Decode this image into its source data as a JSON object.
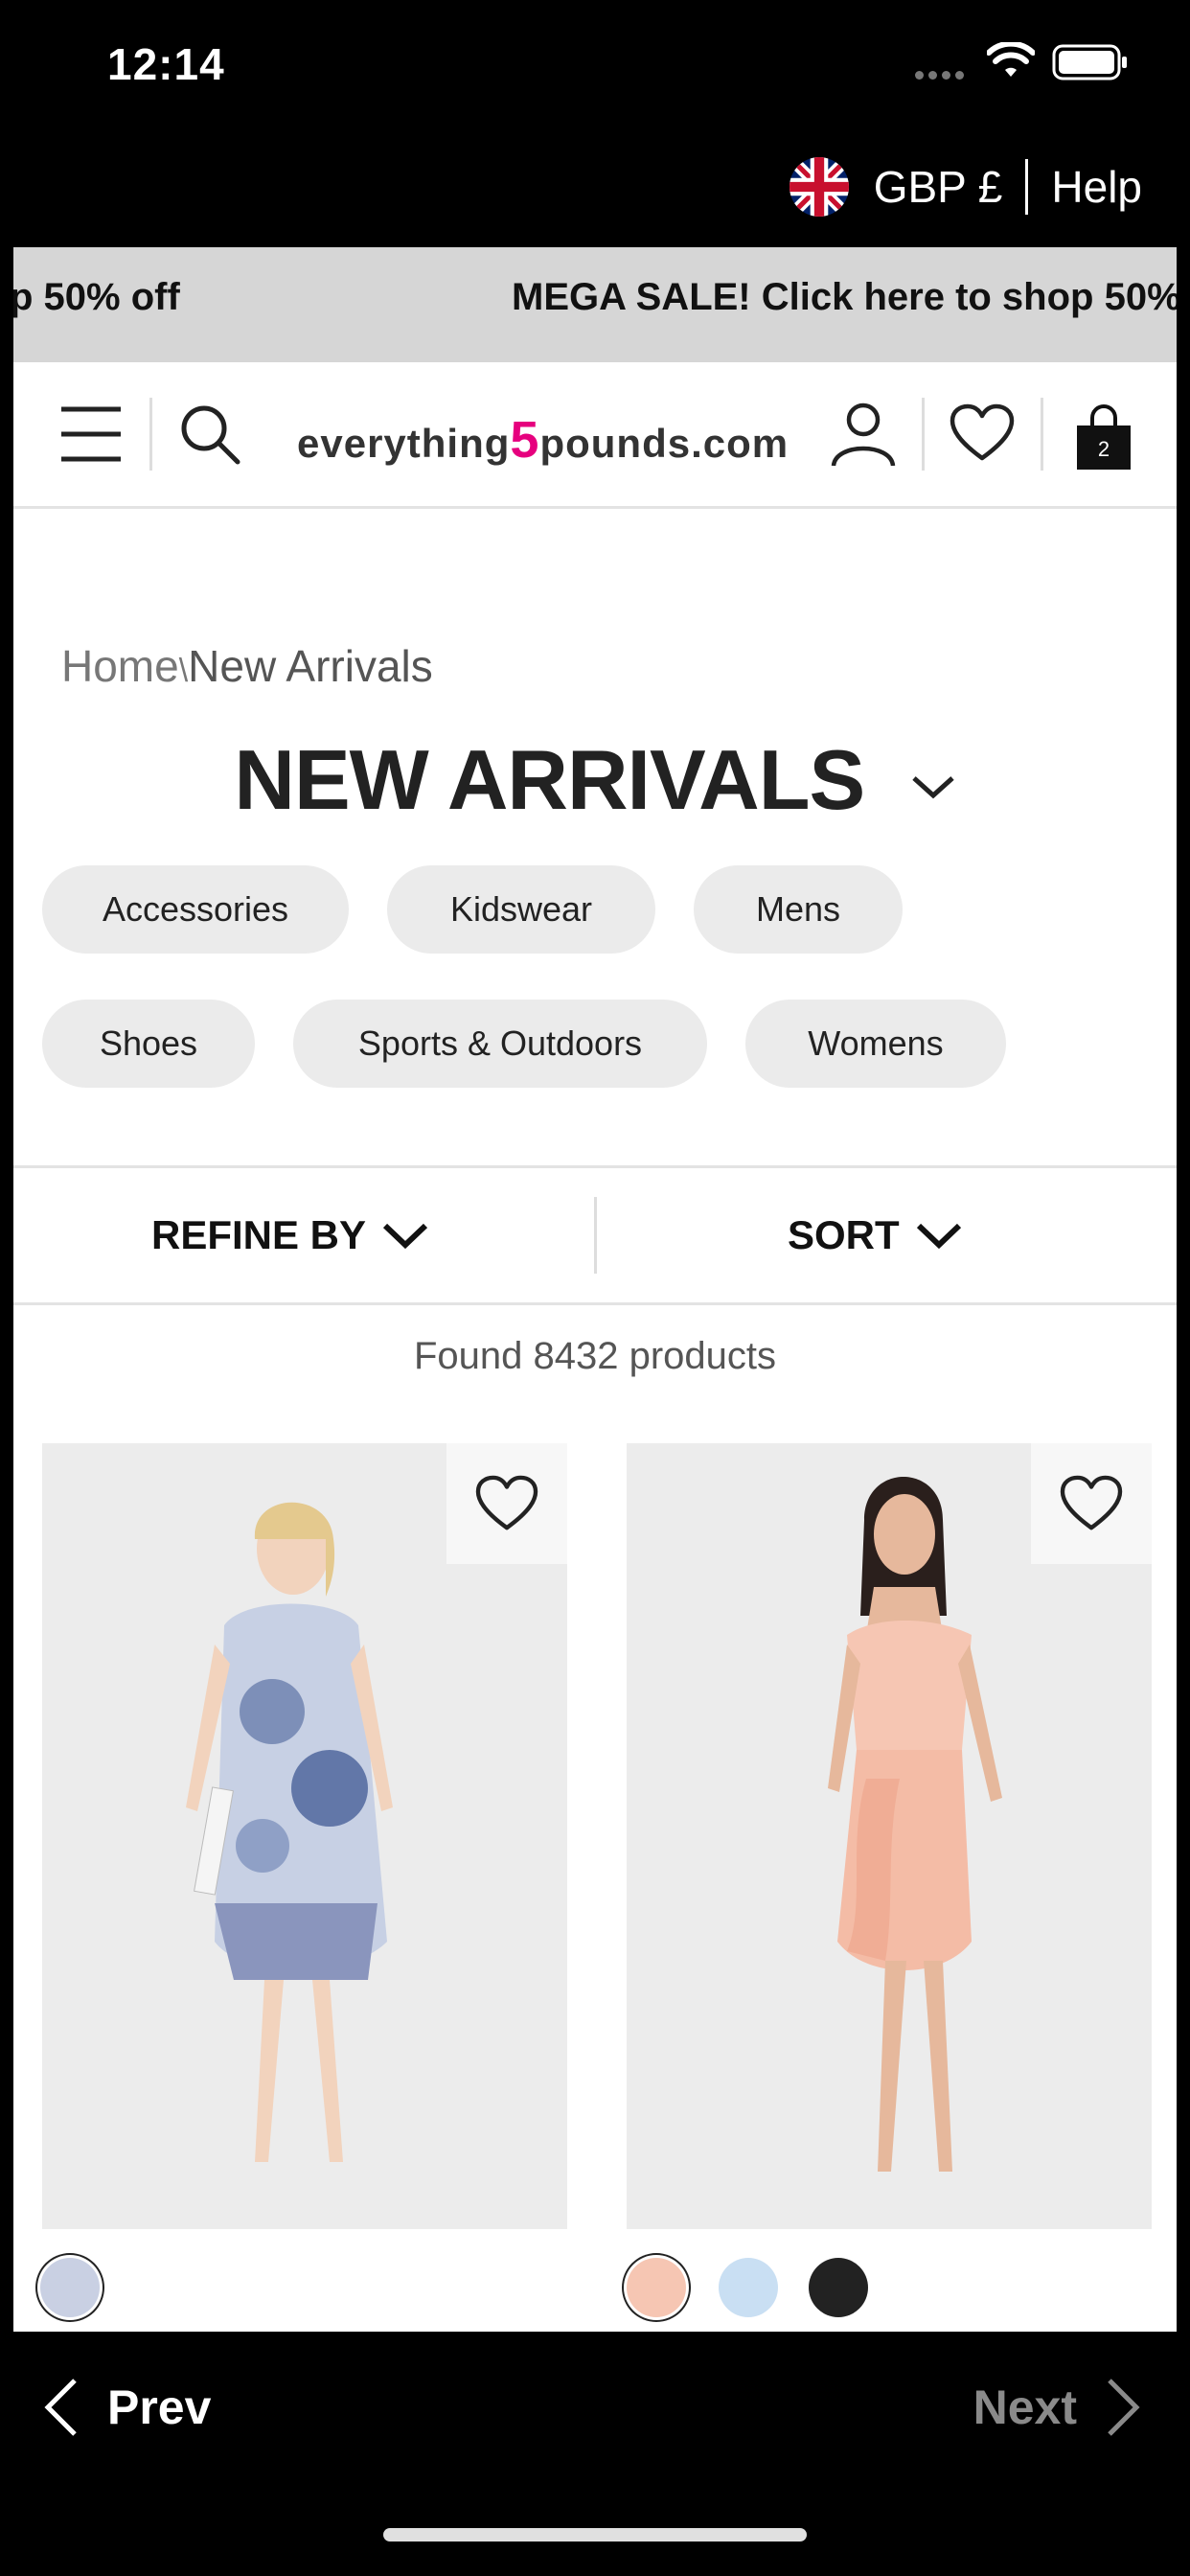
{
  "status_bar": {
    "time": "12:14"
  },
  "locale": {
    "currency": "GBP £",
    "help": "Help"
  },
  "promo": {
    "text_left": "p 50% off",
    "text_right": "MEGA SALE! Click here to shop 50%"
  },
  "header": {
    "logo_part1": "everything",
    "logo_five": "5",
    "logo_part2": "pounds.com",
    "bag_count": "2"
  },
  "breadcrumb": {
    "home": "Home",
    "separator": "\\",
    "current": "New Arrivals"
  },
  "page": {
    "title": "NEW ARRIVALS"
  },
  "categories": [
    "Accessories",
    "Kidswear",
    "Mens",
    "Shoes",
    "Sports & Outdoors",
    "Womens"
  ],
  "filters": {
    "refine": "REFINE BY",
    "sort": "SORT"
  },
  "results": {
    "found_text": "Found 8432 products"
  },
  "products": [
    {
      "swatches": [
        "#c9d0e3"
      ]
    },
    {
      "swatches": [
        "#f6c6b3",
        "#c9dff3",
        "#222222"
      ]
    }
  ],
  "bottom_nav": {
    "prev": "Prev",
    "next": "Next"
  },
  "colors": {
    "accent": "#e6007e",
    "promo_bg": "#d6d6d6",
    "chip_bg": "#ebebeb"
  }
}
